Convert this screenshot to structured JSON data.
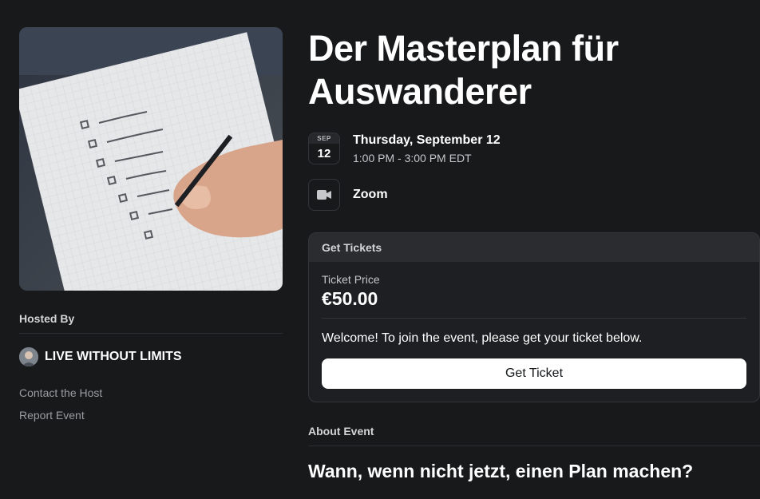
{
  "event": {
    "title_line1": "Der Masterplan für",
    "title_line2": "Auswanderer",
    "date_month": "SEP",
    "date_day": "12",
    "date_full": "Thursday, September 12",
    "time_range": "1:00 PM - 3:00 PM EDT",
    "location": "Zoom",
    "location_icon": "video-camera-icon"
  },
  "host": {
    "hosted_by_label": "Hosted By",
    "name": "LIVE WITHOUT LIMITS",
    "contact_label": "Contact the Host",
    "report_label": "Report Event"
  },
  "tickets": {
    "header": "Get Tickets",
    "price_label": "Ticket Price",
    "price": "€50.00",
    "welcome": "Welcome! To join the event, please get your ticket below.",
    "button_label": "Get Ticket"
  },
  "about": {
    "label": "About Event",
    "heading": "Wann, wenn nicht jetzt, einen Plan machen?"
  },
  "colors": {
    "background": "#18191b",
    "card": "#1e1f22",
    "button": "#ffffff"
  }
}
